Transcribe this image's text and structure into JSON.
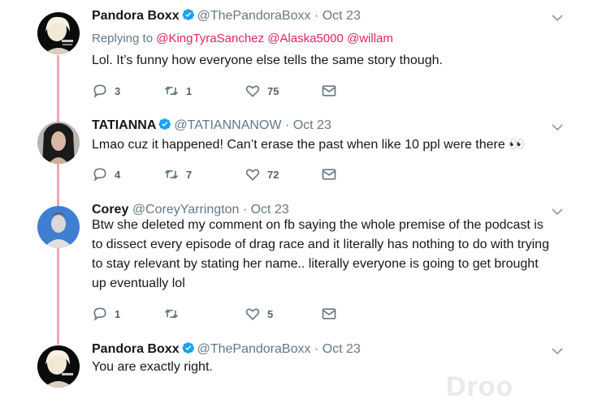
{
  "tweets": [
    {
      "name": "Pandora Boxx",
      "handle": "@ThePandoraBoxx",
      "dot": "·",
      "date": "Oct 23",
      "replying_prefix": "Replying to",
      "replying_to": [
        "@KingTyraSanchez",
        "@Alaska5000",
        "@willam"
      ],
      "text": "Lol. It’s funny how everyone else tells the same story though.",
      "replies": "3",
      "retweets": "1",
      "likes": "75"
    },
    {
      "name": "TATIANNA",
      "handle": "@TATIANNANOW",
      "dot": "·",
      "date": "Oct 23",
      "text": "Lmao cuz it happened! Can’t erase the past when like 10 ppl were there 👀",
      "replies": "4",
      "retweets": "7",
      "likes": "72"
    },
    {
      "name": "Corey",
      "handle": "@CoreyYarrington",
      "dot": "·",
      "date": "Oct 23",
      "text_lines": [
        "Btw she deleted my comment on fb saying the whole premise of the podcast is",
        "to dissect every episode of drag race and it literally has nothing to do with trying",
        "to stay relevant by stating her name.. literally everyone is going to get brought",
        "up eventually lol"
      ],
      "replies": "1",
      "retweets": "",
      "likes": "5"
    },
    {
      "name": "Pandora Boxx",
      "handle": "@ThePandoraBoxx",
      "dot": "·",
      "date": "Oct 23",
      "text": "You are exactly right."
    }
  ],
  "watermark": "Droo",
  "colors": {
    "thread_line": "#f2a2b6",
    "verified": "#1da1f2",
    "mention": "#e0245e"
  }
}
